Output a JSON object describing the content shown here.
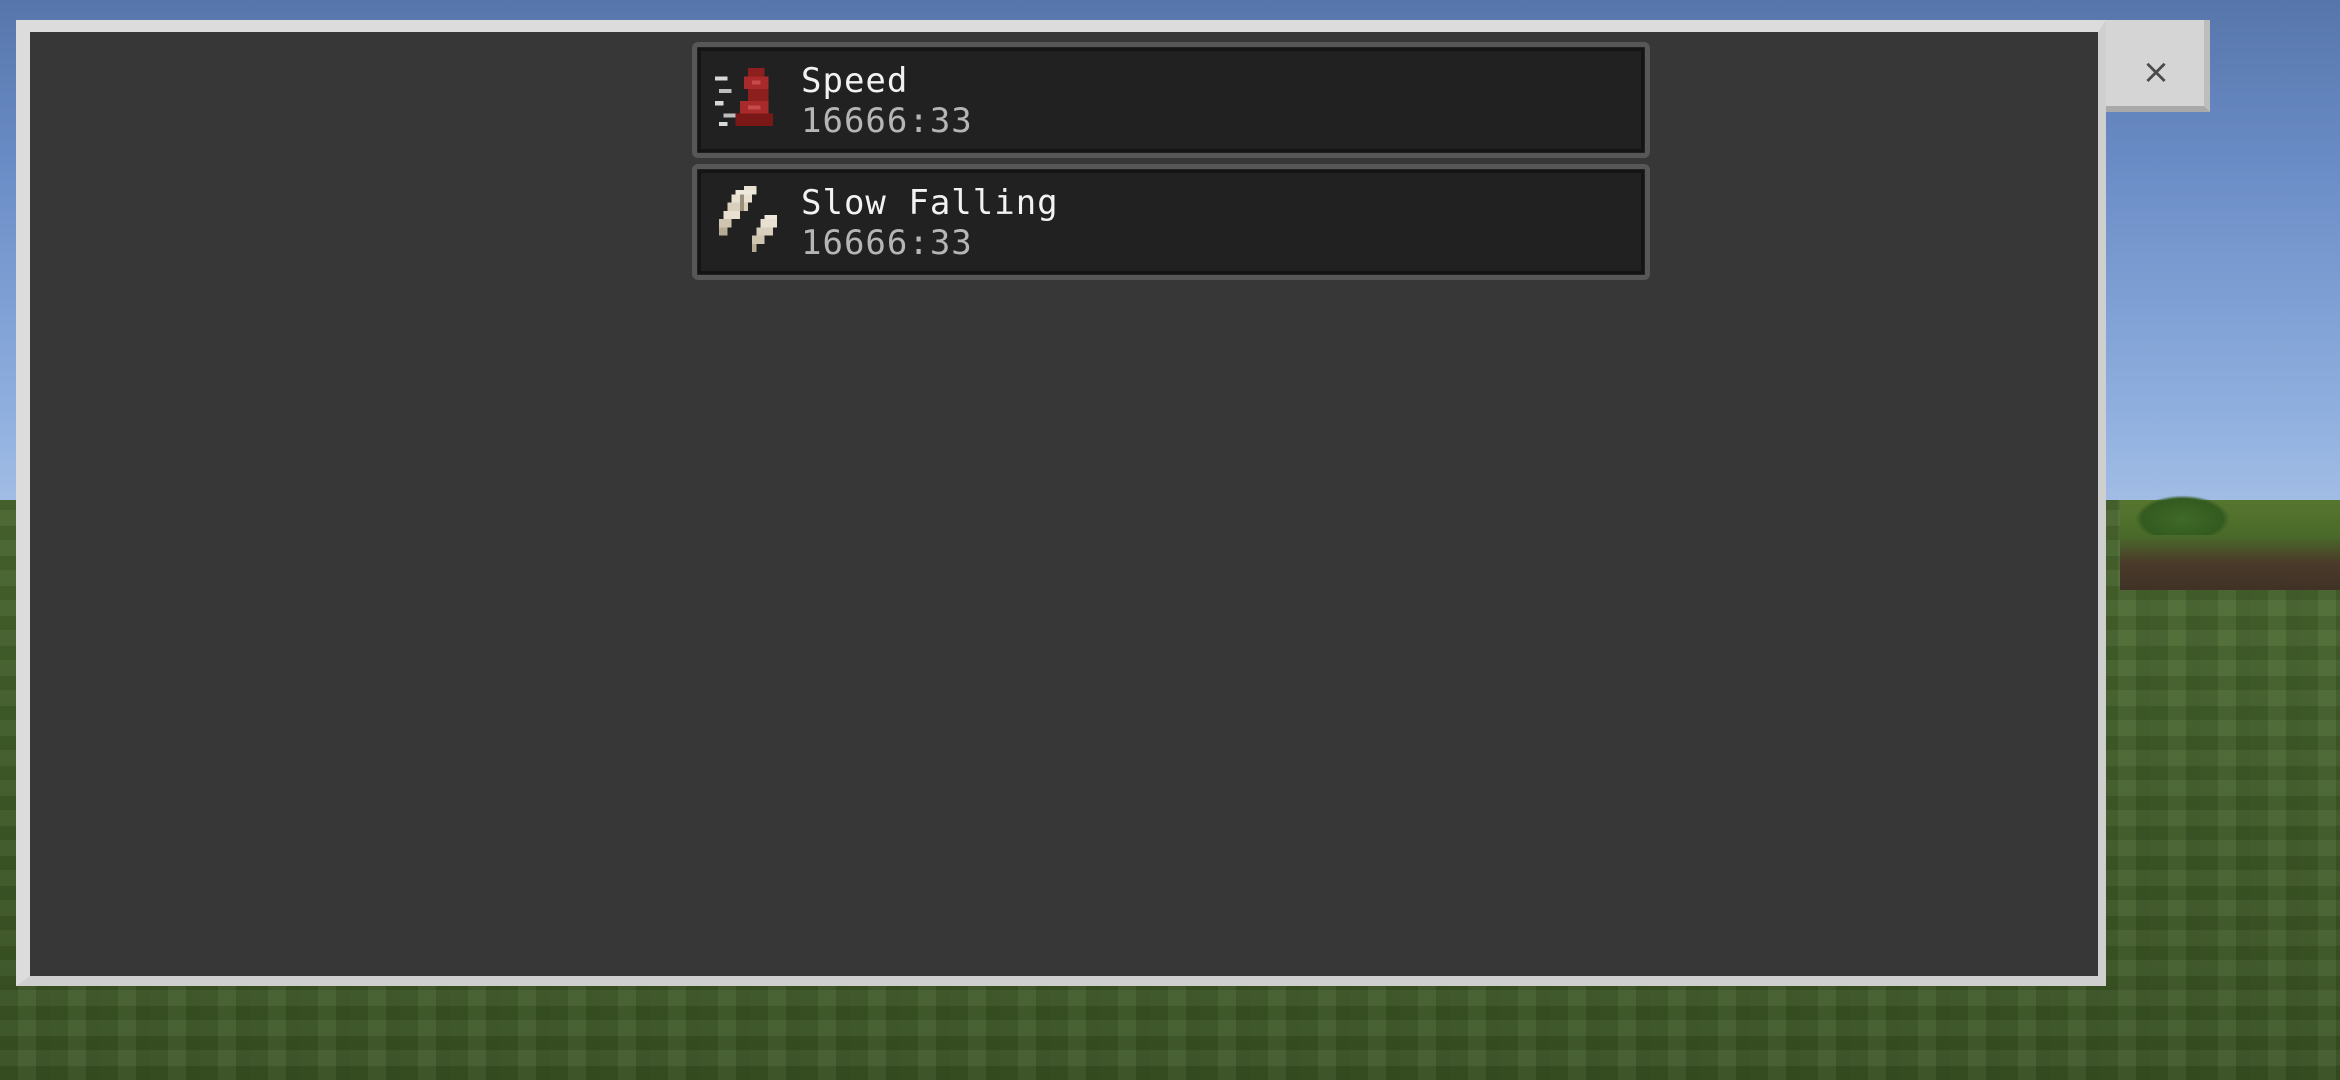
{
  "close_button": {
    "label": "×",
    "icon": "close-icon"
  },
  "effects": [
    {
      "name": "Speed",
      "duration": "16666:33",
      "icon": "speed-boot-icon"
    },
    {
      "name": "Slow Falling",
      "duration": "16666:33",
      "icon": "feather-icon"
    }
  ],
  "colors": {
    "panel_background": "#373737",
    "panel_border": "#dcdcdc",
    "row_background": "#212121",
    "name_text": "#f2f2f2",
    "duration_text": "#b5b5b5"
  }
}
